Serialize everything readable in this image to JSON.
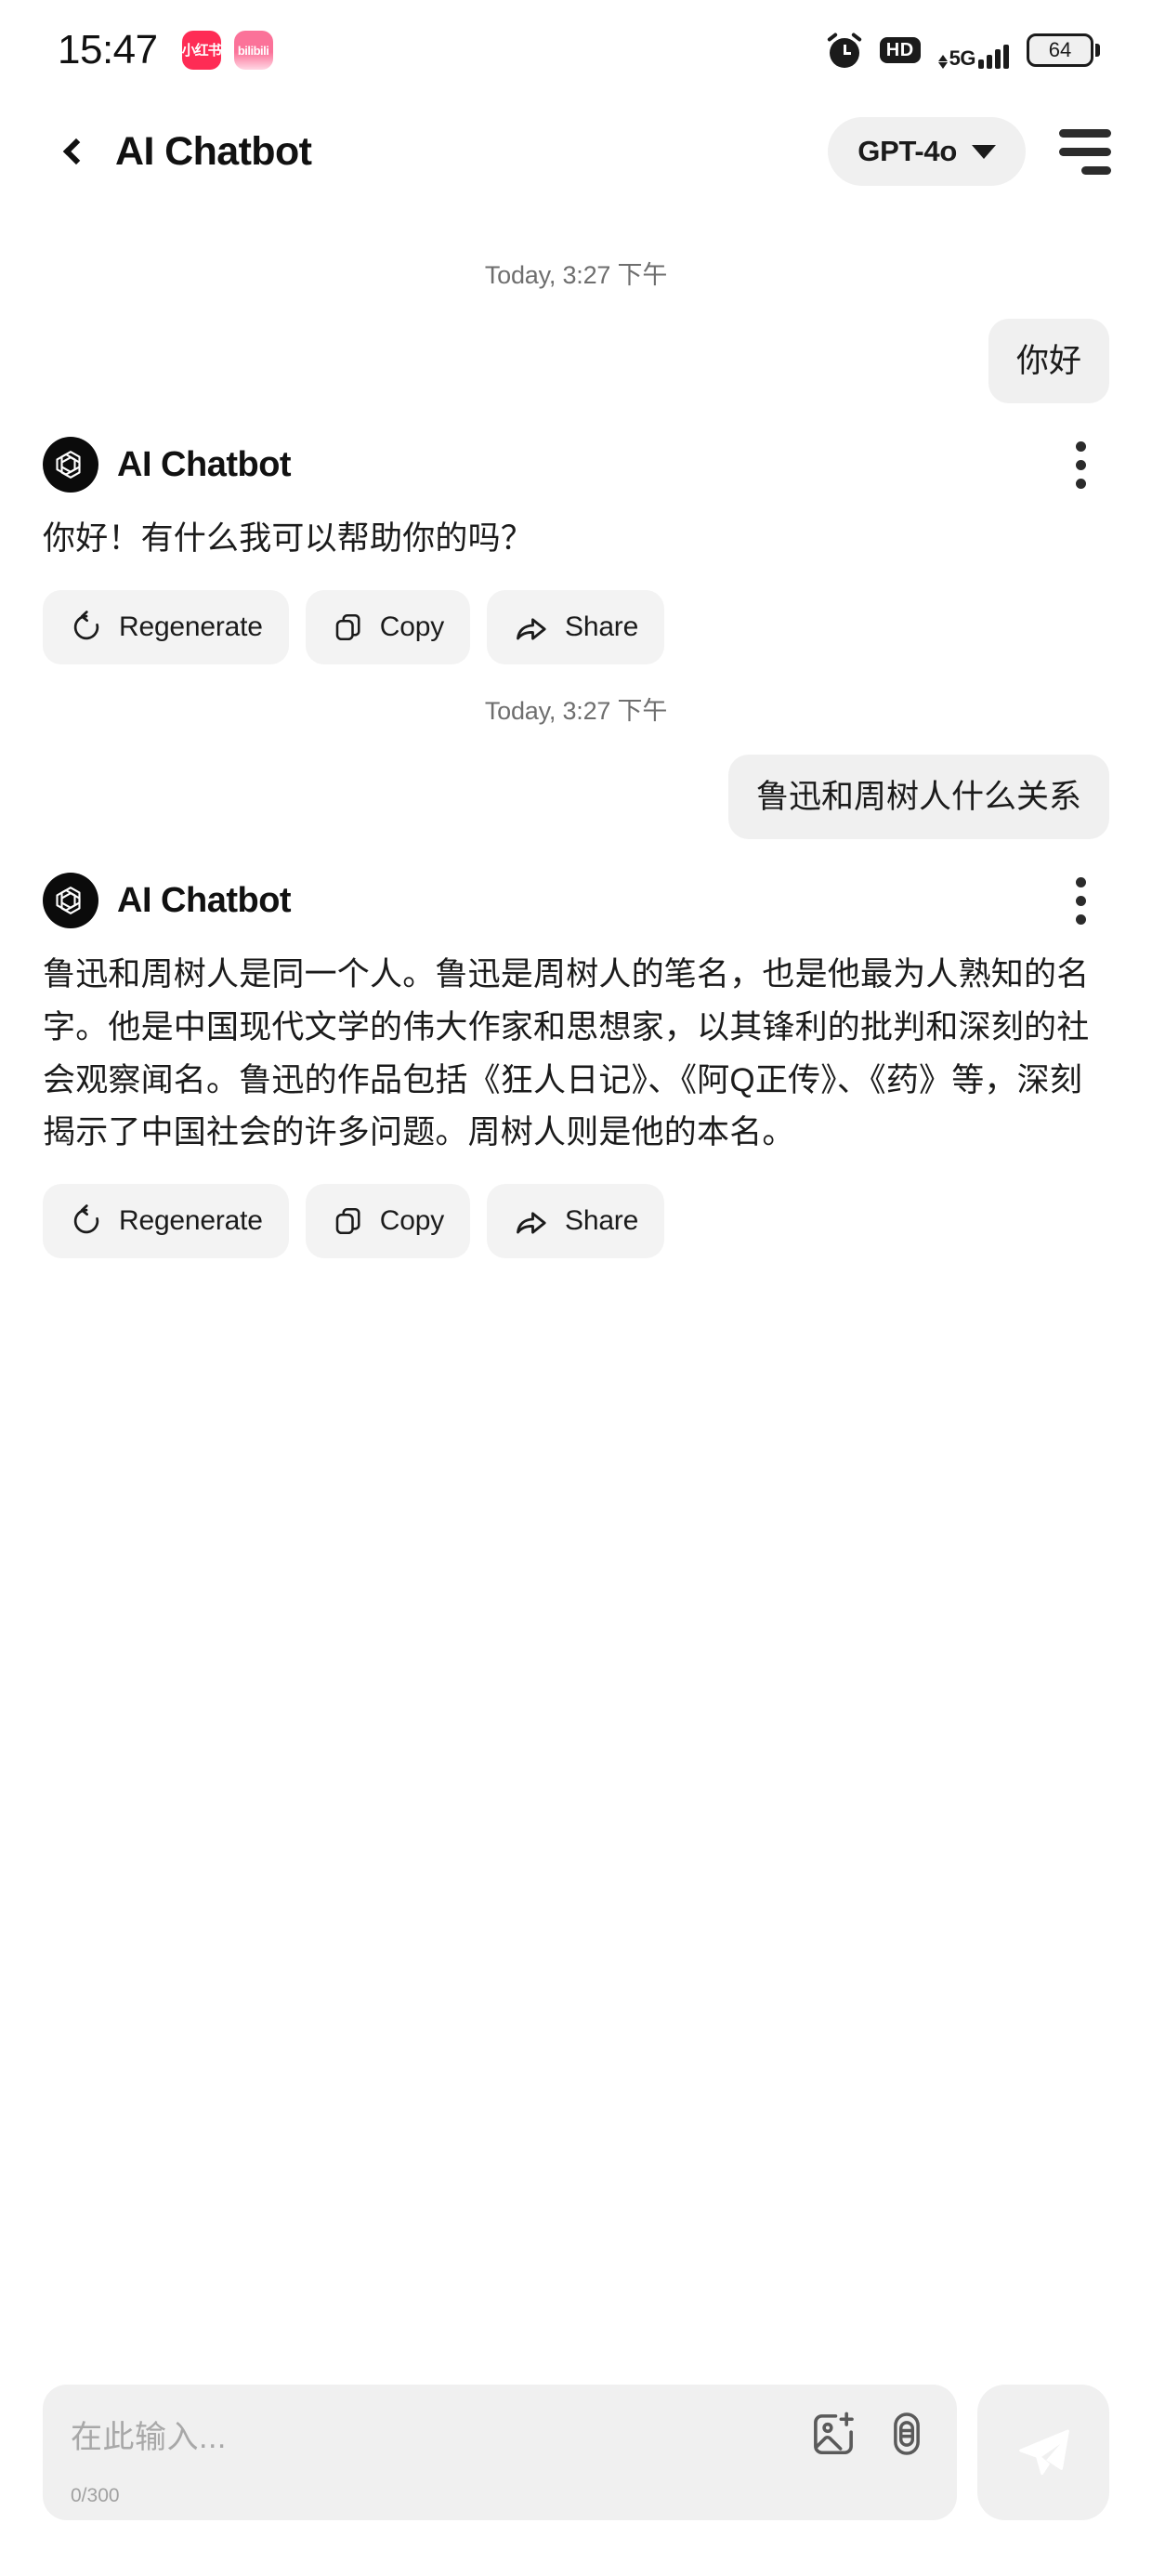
{
  "status_bar": {
    "time": "15:47",
    "apps": [
      {
        "name": "xiaohongshu",
        "label": "小红书"
      },
      {
        "name": "bilibili",
        "label": "bilibili"
      }
    ],
    "alarm_icon": "alarm-clock-icon",
    "hd_label": "HD",
    "network_label": "5G",
    "signal_bars": 4,
    "battery_level": "64"
  },
  "header": {
    "back_icon": "back-chevron-icon",
    "title": "AI Chatbot",
    "model_label": "GPT-4o",
    "model_caret": "chevron-down-icon",
    "menu_icon": "hamburger-menu-icon"
  },
  "chat": {
    "assistant_name": "AI Chatbot",
    "messages": [
      {
        "type": "timestamp",
        "text": "Today, 3:27 下午"
      },
      {
        "type": "user",
        "text": "你好"
      },
      {
        "type": "assistant",
        "name": "AI Chatbot",
        "text": "你好！有什么我可以帮助你的吗？",
        "actions": [
          {
            "icon": "regenerate-icon",
            "label": "Regenerate"
          },
          {
            "icon": "copy-icon",
            "label": "Copy"
          },
          {
            "icon": "share-icon",
            "label": "Share"
          }
        ]
      },
      {
        "type": "timestamp",
        "text": "Today, 3:27 下午"
      },
      {
        "type": "user",
        "text": "鲁迅和周树人什么关系"
      },
      {
        "type": "assistant",
        "name": "AI Chatbot",
        "text": "鲁迅和周树人是同一个人。鲁迅是周树人的笔名，也是他最为人熟知的名字。他是中国现代文学的伟大作家和思想家，以其锋利的批判和深刻的社会观察闻名。鲁迅的作品包括《狂人日记》、《阿Q正传》、《药》等，深刻揭示了中国社会的许多问题。周树人则是他的本名。",
        "actions": [
          {
            "icon": "regenerate-icon",
            "label": "Regenerate"
          },
          {
            "icon": "copy-icon",
            "label": "Copy"
          },
          {
            "icon": "share-icon",
            "label": "Share"
          }
        ]
      }
    ]
  },
  "composer": {
    "placeholder": "在此输入...",
    "value": "",
    "counter": "0/300",
    "image_icon": "add-image-icon",
    "mic_icon": "microphone-icon",
    "send_icon": "send-paper-plane-icon"
  },
  "colors": {
    "bubble_bg": "#f0f0f0",
    "chip_bg": "#f3f3f3",
    "text": "#1b1b1b",
    "muted": "#6e6e6e",
    "placeholder": "#a8a8a8"
  }
}
